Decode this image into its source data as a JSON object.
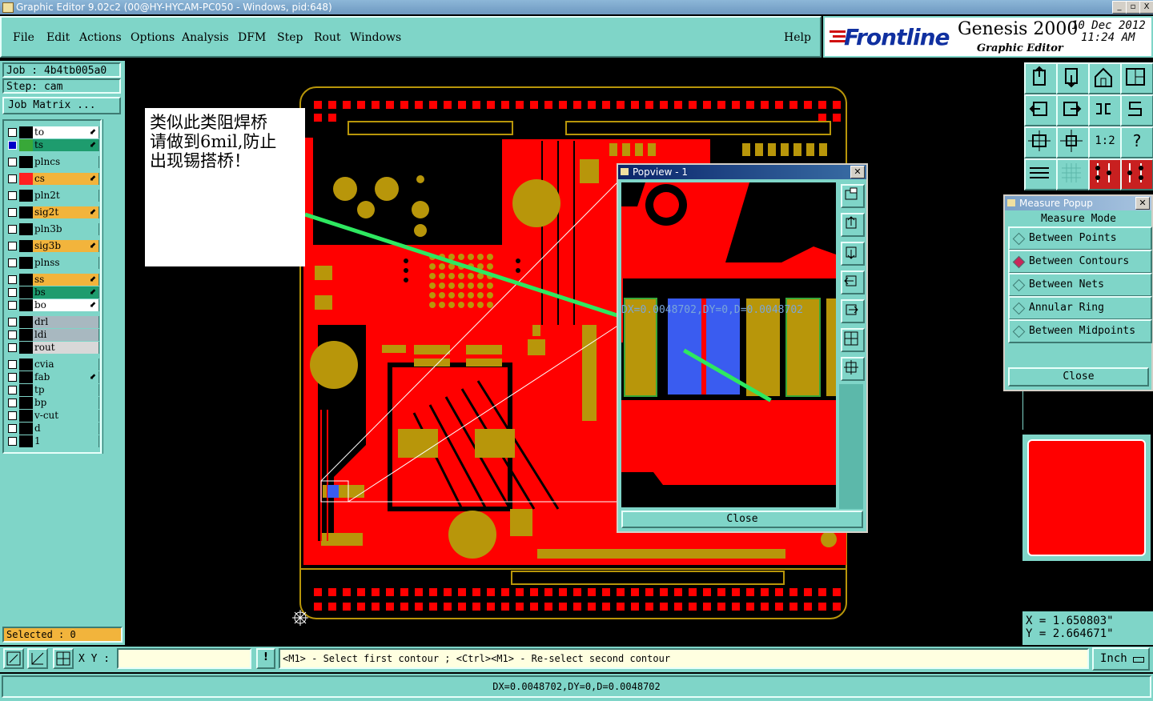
{
  "window": {
    "title": "Graphic Editor 9.02c2 (00@HY-HYCAM-PC050 - Windows, pid:648)",
    "buttons": [
      "_",
      "▫",
      "X"
    ]
  },
  "menu": [
    "File",
    "Edit",
    "Actions",
    "Options",
    "Analysis",
    "DFM",
    "Step",
    "Rout",
    "Windows"
  ],
  "help_label": "Help",
  "logo": {
    "brand": "Frontline",
    "product": "Genesis 2000",
    "subtitle": "Graphic Editor",
    "date": "10 Dec 2012",
    "time": "11:24 AM"
  },
  "job": {
    "job_line": "Job : 4b4tb005a0",
    "step_line": "Step: cam",
    "matrix_button": "Job Matrix ..."
  },
  "layers": [
    {
      "name": "to",
      "color": "#ffffff",
      "swatch": "#000000",
      "arrow": "⬋"
    },
    {
      "name": "ts",
      "color": "#1e9c6e",
      "swatch": "#38a838",
      "arrow": "⬋",
      "selected": true
    },
    {
      "name": "plncs",
      "color": "#7fd5c8",
      "swatch": "#000000",
      "arrow": ""
    },
    {
      "name": "cs",
      "color": "#f2b43c",
      "swatch": "#ff2020",
      "arrow": "⬋"
    },
    {
      "name": "pln2t",
      "color": "#7fd5c8",
      "swatch": "#000000",
      "arrow": ""
    },
    {
      "name": "sig2t",
      "color": "#f2b43c",
      "swatch": "#000000",
      "arrow": "⬋"
    },
    {
      "name": "pln3b",
      "color": "#7fd5c8",
      "swatch": "#000000",
      "arrow": ""
    },
    {
      "name": "sig3b",
      "color": "#f2b43c",
      "swatch": "#000000",
      "arrow": "⬋"
    },
    {
      "name": "plnss",
      "color": "#7fd5c8",
      "swatch": "#000000",
      "arrow": ""
    },
    {
      "name": "ss",
      "color": "#f2b43c",
      "swatch": "#000000",
      "arrow": "⬋"
    },
    {
      "name": "bs",
      "color": "#1e9c6e",
      "swatch": "#000000",
      "arrow": "⬋"
    },
    {
      "name": "bo",
      "color": "#ffffff",
      "swatch": "#000000",
      "arrow": "⬋"
    },
    {
      "name": "drl",
      "color": "#a8b8c0",
      "swatch": "#000000",
      "arrow": ""
    },
    {
      "name": "ldi",
      "color": "#a8b8c0",
      "swatch": "#000000",
      "arrow": ""
    },
    {
      "name": "rout",
      "color": "#d8d8d8",
      "swatch": "#000000",
      "arrow": ""
    },
    {
      "name": "cvia",
      "color": "#7fd5c8",
      "swatch": "#000000",
      "arrow": ""
    },
    {
      "name": "fab",
      "color": "#7fd5c8",
      "swatch": "#000000",
      "arrow": "⬋"
    },
    {
      "name": "tp",
      "color": "#7fd5c8",
      "swatch": "#000000",
      "arrow": ""
    },
    {
      "name": "bp",
      "color": "#7fd5c8",
      "swatch": "#000000",
      "arrow": ""
    },
    {
      "name": "v-cut",
      "color": "#7fd5c8",
      "swatch": "#000000",
      "arrow": ""
    },
    {
      "name": "d",
      "color": "#7fd5c8",
      "swatch": "#000000",
      "arrow": ""
    },
    {
      "name": "1",
      "color": "#7fd5c8",
      "swatch": "#000000",
      "arrow": ""
    }
  ],
  "selected_label": "Selected : 0",
  "annotation": {
    "line1": "类似此类阻焊桥",
    "line2": "请做到6mil,防止",
    "line3": "出现锡搭桥！"
  },
  "popview": {
    "title": "Popview - 1",
    "measure_text": "DX=0.0048702,DY=0,D=0.0048702",
    "close_label": "Close"
  },
  "measure_popup": {
    "title": "Measure Popup",
    "header": "Measure Mode",
    "options": [
      {
        "label": "Between Points",
        "active": false
      },
      {
        "label": "Between Contours",
        "active": true
      },
      {
        "label": "Between Nets",
        "active": false
      },
      {
        "label": "Annular Ring",
        "active": false
      },
      {
        "label": "Between Midpoints",
        "active": false
      }
    ],
    "close_label": "Close"
  },
  "coords": {
    "x": "X = 1.650803\"",
    "y": "Y = 2.664671\""
  },
  "xy_label": "X Y :",
  "xy_value": "",
  "prompt": "<M1> - Select first contour ; <Ctrl><M1> - Re-select second contour",
  "units": "Inch",
  "status": "DX=0.0048702,DY=0,D=0.0048702",
  "colors": {
    "teal": "#7fd5c8",
    "board_red": "#ff0000",
    "pad_gold": "#b8960a",
    "trace_green": "#2ee860"
  }
}
